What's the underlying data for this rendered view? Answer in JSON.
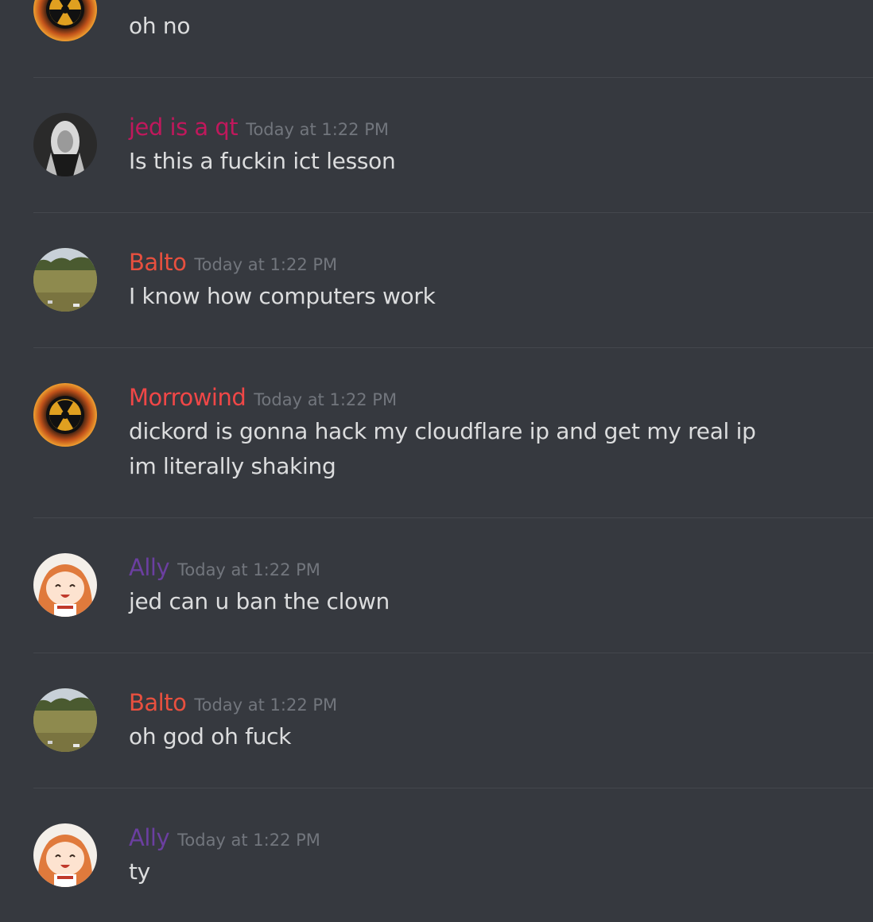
{
  "colors": {
    "background": "#36393f",
    "divider": "#44474d",
    "timestamp": "#72767d",
    "message_text": "#dcddde"
  },
  "messages": [
    {
      "avatar": "radiation-avatar-icon",
      "username": "",
      "name_color": "#f04747",
      "timestamp": "",
      "lines": [
        "oh no"
      ]
    },
    {
      "avatar": "grayscale-person-avatar-icon",
      "username": "jed is a qt",
      "name_color": "#c0185c",
      "timestamp": "Today at 1:22 PM",
      "lines": [
        "Is this a fuckin ict lesson"
      ]
    },
    {
      "avatar": "field-landscape-avatar-icon",
      "username": "Balto",
      "name_color": "#e8503f",
      "timestamp": "Today at 1:22 PM",
      "lines": [
        "I know how computers work"
      ]
    },
    {
      "avatar": "radiation-avatar-icon",
      "username": "Morrowind",
      "name_color": "#f04747",
      "timestamp": "Today at 1:22 PM",
      "lines": [
        "dickord is gonna hack my cloudflare ip and get my real ip",
        "im literally shaking"
      ]
    },
    {
      "avatar": "anime-girl-avatar-icon",
      "username": "Ally",
      "name_color": "#6b3fa0",
      "timestamp": "Today at 1:22 PM",
      "lines": [
        "jed can u ban the clown"
      ]
    },
    {
      "avatar": "field-landscape-avatar-icon",
      "username": "Balto",
      "name_color": "#e8503f",
      "timestamp": "Today at 1:22 PM",
      "lines": [
        "oh god oh fuck"
      ]
    },
    {
      "avatar": "anime-girl-avatar-icon",
      "username": "Ally",
      "name_color": "#6b3fa0",
      "timestamp": "Today at 1:22 PM",
      "lines": [
        "ty"
      ]
    }
  ]
}
